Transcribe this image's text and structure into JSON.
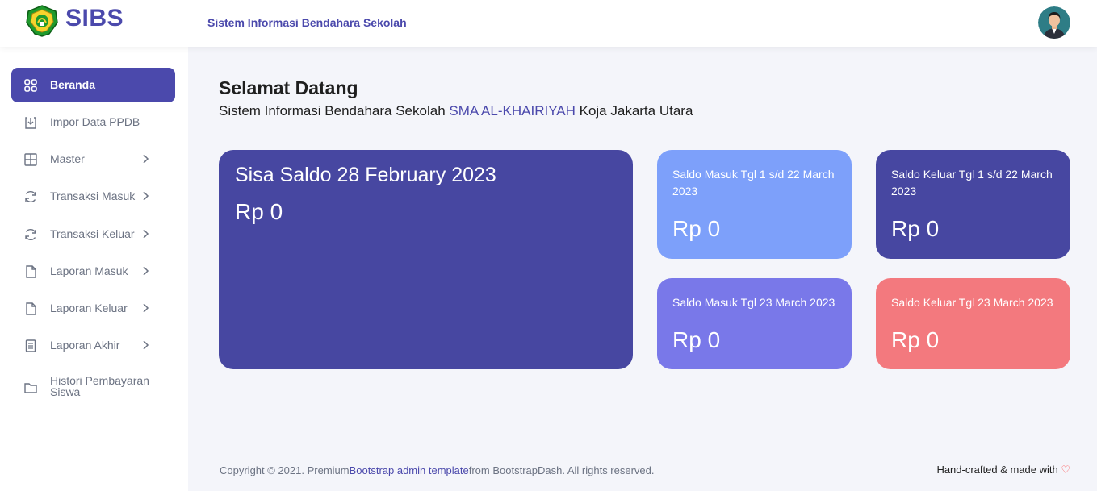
{
  "brand": {
    "name": "SIBS",
    "subtitle": "Sistem Informasi Bendahara Sekolah",
    "logo_icon": "school-emblem-icon"
  },
  "user": {
    "avatar_icon": "user-avatar-icon"
  },
  "sidebar": {
    "items": [
      {
        "label": "Beranda",
        "icon": "grid-icon",
        "active": true
      },
      {
        "label": "Impor Data PPDB",
        "icon": "download-icon"
      },
      {
        "label": "Master",
        "icon": "table-icon",
        "has_submenu": true
      },
      {
        "label": "Transaksi Masuk",
        "icon": "refresh-icon",
        "has_submenu": true
      },
      {
        "label": "Transaksi Keluar",
        "icon": "refresh-icon",
        "has_submenu": true
      },
      {
        "label": "Laporan Masuk",
        "icon": "file-icon",
        "has_submenu": true
      },
      {
        "label": "Laporan Keluar",
        "icon": "file-icon",
        "has_submenu": true
      },
      {
        "label": "Laporan Akhir",
        "icon": "document-icon",
        "has_submenu": true
      },
      {
        "label_line1": "Histori Pembayaran",
        "label_line2": "Siswa",
        "icon": "folder-icon"
      }
    ]
  },
  "welcome": {
    "title": "Selamat Datang",
    "sub_prefix": "Sistem Informasi Bendahara Sekolah ",
    "school": "SMA AL-KHAIRIYAH",
    "sub_suffix": " Koja Jakarta Utara"
  },
  "cards": {
    "big": {
      "label": "Sisa Saldo 28 February 2023",
      "value": "Rp 0",
      "color": "#4747a1"
    },
    "masuk_range": {
      "label": "Saldo Masuk Tgl 1 s/d 22 March 2023",
      "value": "Rp 0",
      "color": "#7da0fa"
    },
    "keluar_range": {
      "label": "Saldo Keluar Tgl 1 s/d 22 March 2023",
      "value": "Rp 0",
      "color": "#4747a1"
    },
    "masuk_day": {
      "label": "Saldo Masuk Tgl 23 March 2023",
      "value": "Rp 0",
      "color": "#7978e9"
    },
    "keluar_day": {
      "label": "Saldo Keluar Tgl 23 March 2023",
      "value": "Rp 0",
      "color": "#f3797e"
    }
  },
  "footer": {
    "copyright_prefix": "Copyright © 2021. Premium",
    "link_text": "Bootstrap admin template",
    "copyright_suffix": "from BootstrapDash. All rights reserved.",
    "right_text": "Hand-crafted & made with ",
    "heart_icon": "heart-icon"
  },
  "colors": {
    "accent": "#4b49ac",
    "background": "#f4f5fa"
  }
}
